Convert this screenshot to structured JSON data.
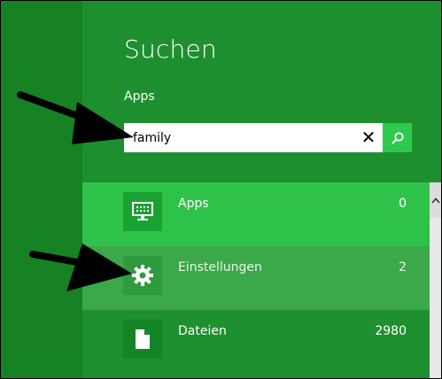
{
  "search": {
    "title": "Suchen",
    "scope": "Apps",
    "query": "family",
    "clear_symbol": "✕"
  },
  "results": [
    {
      "label": "Apps",
      "count": "0",
      "icon": "desktop-app-icon"
    },
    {
      "label": "Einstellungen",
      "count": "2",
      "icon": "gear-icon"
    },
    {
      "label": "Dateien",
      "count": "2980",
      "icon": "file-icon"
    }
  ],
  "colors": {
    "pane": "#1e8f2f",
    "left_strip": "#168224",
    "row_selected": "#2fc24a",
    "row_hover": "#3ba84a",
    "search_button": "#2ccb4b"
  }
}
